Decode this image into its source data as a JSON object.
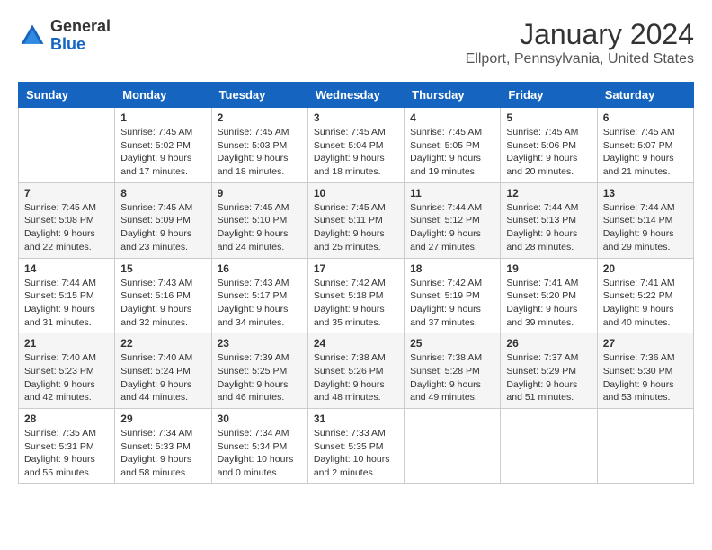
{
  "header": {
    "logo_general": "General",
    "logo_blue": "Blue",
    "month_title": "January 2024",
    "location": "Ellport, Pennsylvania, United States"
  },
  "weekdays": [
    "Sunday",
    "Monday",
    "Tuesday",
    "Wednesday",
    "Thursday",
    "Friday",
    "Saturday"
  ],
  "weeks": [
    [
      {
        "day": "",
        "sunrise": "",
        "sunset": "",
        "daylight": ""
      },
      {
        "day": "1",
        "sunrise": "Sunrise: 7:45 AM",
        "sunset": "Sunset: 5:02 PM",
        "daylight": "Daylight: 9 hours and 17 minutes."
      },
      {
        "day": "2",
        "sunrise": "Sunrise: 7:45 AM",
        "sunset": "Sunset: 5:03 PM",
        "daylight": "Daylight: 9 hours and 18 minutes."
      },
      {
        "day": "3",
        "sunrise": "Sunrise: 7:45 AM",
        "sunset": "Sunset: 5:04 PM",
        "daylight": "Daylight: 9 hours and 18 minutes."
      },
      {
        "day": "4",
        "sunrise": "Sunrise: 7:45 AM",
        "sunset": "Sunset: 5:05 PM",
        "daylight": "Daylight: 9 hours and 19 minutes."
      },
      {
        "day": "5",
        "sunrise": "Sunrise: 7:45 AM",
        "sunset": "Sunset: 5:06 PM",
        "daylight": "Daylight: 9 hours and 20 minutes."
      },
      {
        "day": "6",
        "sunrise": "Sunrise: 7:45 AM",
        "sunset": "Sunset: 5:07 PM",
        "daylight": "Daylight: 9 hours and 21 minutes."
      }
    ],
    [
      {
        "day": "7",
        "sunrise": "Sunrise: 7:45 AM",
        "sunset": "Sunset: 5:08 PM",
        "daylight": "Daylight: 9 hours and 22 minutes."
      },
      {
        "day": "8",
        "sunrise": "Sunrise: 7:45 AM",
        "sunset": "Sunset: 5:09 PM",
        "daylight": "Daylight: 9 hours and 23 minutes."
      },
      {
        "day": "9",
        "sunrise": "Sunrise: 7:45 AM",
        "sunset": "Sunset: 5:10 PM",
        "daylight": "Daylight: 9 hours and 24 minutes."
      },
      {
        "day": "10",
        "sunrise": "Sunrise: 7:45 AM",
        "sunset": "Sunset: 5:11 PM",
        "daylight": "Daylight: 9 hours and 25 minutes."
      },
      {
        "day": "11",
        "sunrise": "Sunrise: 7:44 AM",
        "sunset": "Sunset: 5:12 PM",
        "daylight": "Daylight: 9 hours and 27 minutes."
      },
      {
        "day": "12",
        "sunrise": "Sunrise: 7:44 AM",
        "sunset": "Sunset: 5:13 PM",
        "daylight": "Daylight: 9 hours and 28 minutes."
      },
      {
        "day": "13",
        "sunrise": "Sunrise: 7:44 AM",
        "sunset": "Sunset: 5:14 PM",
        "daylight": "Daylight: 9 hours and 29 minutes."
      }
    ],
    [
      {
        "day": "14",
        "sunrise": "Sunrise: 7:44 AM",
        "sunset": "Sunset: 5:15 PM",
        "daylight": "Daylight: 9 hours and 31 minutes."
      },
      {
        "day": "15",
        "sunrise": "Sunrise: 7:43 AM",
        "sunset": "Sunset: 5:16 PM",
        "daylight": "Daylight: 9 hours and 32 minutes."
      },
      {
        "day": "16",
        "sunrise": "Sunrise: 7:43 AM",
        "sunset": "Sunset: 5:17 PM",
        "daylight": "Daylight: 9 hours and 34 minutes."
      },
      {
        "day": "17",
        "sunrise": "Sunrise: 7:42 AM",
        "sunset": "Sunset: 5:18 PM",
        "daylight": "Daylight: 9 hours and 35 minutes."
      },
      {
        "day": "18",
        "sunrise": "Sunrise: 7:42 AM",
        "sunset": "Sunset: 5:19 PM",
        "daylight": "Daylight: 9 hours and 37 minutes."
      },
      {
        "day": "19",
        "sunrise": "Sunrise: 7:41 AM",
        "sunset": "Sunset: 5:20 PM",
        "daylight": "Daylight: 9 hours and 39 minutes."
      },
      {
        "day": "20",
        "sunrise": "Sunrise: 7:41 AM",
        "sunset": "Sunset: 5:22 PM",
        "daylight": "Daylight: 9 hours and 40 minutes."
      }
    ],
    [
      {
        "day": "21",
        "sunrise": "Sunrise: 7:40 AM",
        "sunset": "Sunset: 5:23 PM",
        "daylight": "Daylight: 9 hours and 42 minutes."
      },
      {
        "day": "22",
        "sunrise": "Sunrise: 7:40 AM",
        "sunset": "Sunset: 5:24 PM",
        "daylight": "Daylight: 9 hours and 44 minutes."
      },
      {
        "day": "23",
        "sunrise": "Sunrise: 7:39 AM",
        "sunset": "Sunset: 5:25 PM",
        "daylight": "Daylight: 9 hours and 46 minutes."
      },
      {
        "day": "24",
        "sunrise": "Sunrise: 7:38 AM",
        "sunset": "Sunset: 5:26 PM",
        "daylight": "Daylight: 9 hours and 48 minutes."
      },
      {
        "day": "25",
        "sunrise": "Sunrise: 7:38 AM",
        "sunset": "Sunset: 5:28 PM",
        "daylight": "Daylight: 9 hours and 49 minutes."
      },
      {
        "day": "26",
        "sunrise": "Sunrise: 7:37 AM",
        "sunset": "Sunset: 5:29 PM",
        "daylight": "Daylight: 9 hours and 51 minutes."
      },
      {
        "day": "27",
        "sunrise": "Sunrise: 7:36 AM",
        "sunset": "Sunset: 5:30 PM",
        "daylight": "Daylight: 9 hours and 53 minutes."
      }
    ],
    [
      {
        "day": "28",
        "sunrise": "Sunrise: 7:35 AM",
        "sunset": "Sunset: 5:31 PM",
        "daylight": "Daylight: 9 hours and 55 minutes."
      },
      {
        "day": "29",
        "sunrise": "Sunrise: 7:34 AM",
        "sunset": "Sunset: 5:33 PM",
        "daylight": "Daylight: 9 hours and 58 minutes."
      },
      {
        "day": "30",
        "sunrise": "Sunrise: 7:34 AM",
        "sunset": "Sunset: 5:34 PM",
        "daylight": "Daylight: 10 hours and 0 minutes."
      },
      {
        "day": "31",
        "sunrise": "Sunrise: 7:33 AM",
        "sunset": "Sunset: 5:35 PM",
        "daylight": "Daylight: 10 hours and 2 minutes."
      },
      {
        "day": "",
        "sunrise": "",
        "sunset": "",
        "daylight": ""
      },
      {
        "day": "",
        "sunrise": "",
        "sunset": "",
        "daylight": ""
      },
      {
        "day": "",
        "sunrise": "",
        "sunset": "",
        "daylight": ""
      }
    ]
  ]
}
